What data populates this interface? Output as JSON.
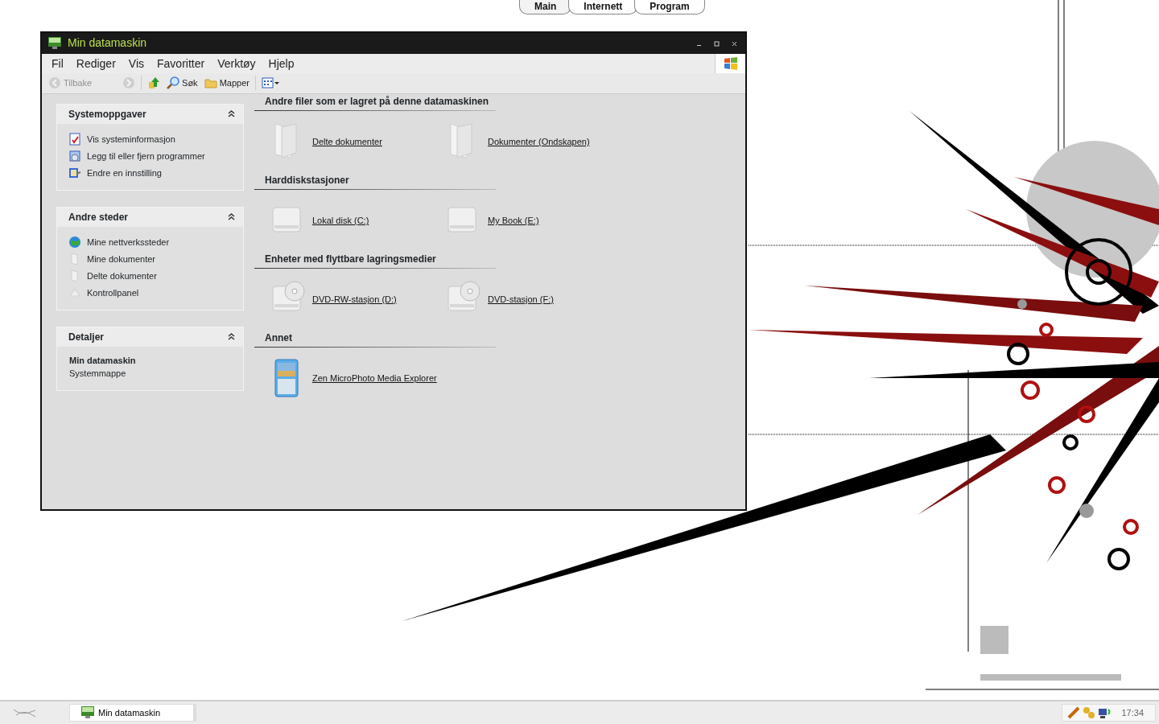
{
  "top_tabs": [
    {
      "label": "Main",
      "selected": true
    },
    {
      "label": "Internett",
      "selected": false
    },
    {
      "label": "Program",
      "selected": false
    }
  ],
  "window": {
    "title": "Min datamaskin",
    "menu": [
      "Fil",
      "Rediger",
      "Vis",
      "Favoritter",
      "Verktøy",
      "Hjelp"
    ],
    "toolbar": [
      {
        "kind": "back",
        "label": "Tilbake",
        "disabled": true
      },
      {
        "kind": "forward",
        "disabled": true
      },
      {
        "kind": "up",
        "disabled": false
      },
      {
        "kind": "search",
        "label": "Søk",
        "disabled": false
      },
      {
        "kind": "folders",
        "label": "Mapper",
        "disabled": false
      },
      {
        "kind": "views",
        "disabled": false
      }
    ],
    "panels": [
      {
        "kind": "tasks",
        "title": "Systemoppgaver",
        "expanded": true,
        "items": [
          {
            "kind": "sysinfo",
            "label": "Vis systeminformasjon"
          },
          {
            "kind": "programs",
            "label": "Legg til eller fjern programmer"
          },
          {
            "kind": "settings",
            "label": "Endre en innstilling"
          }
        ]
      },
      {
        "kind": "tasks",
        "title": "Andre steder",
        "expanded": true,
        "items": [
          {
            "kind": "network",
            "label": "Mine nettverkssteder"
          },
          {
            "kind": "folder",
            "label": "Mine dokumenter"
          },
          {
            "kind": "folder",
            "label": "Delte dokumenter"
          },
          {
            "kind": "control",
            "label": "Kontrollpanel"
          }
        ]
      },
      {
        "kind": "details",
        "title": "Detaljer",
        "expanded": true,
        "name": "Min datamaskin",
        "subtitle": "Systemmappe"
      }
    ],
    "groups": [
      {
        "title": "Andre filer som er lagret på denne datamaskinen",
        "items": [
          {
            "kind": "folder",
            "label": "Delte dokumenter"
          },
          {
            "kind": "folder",
            "label": "Dokumenter (Ondskapen)"
          }
        ]
      },
      {
        "title": "Harddiskstasjoner",
        "items": [
          {
            "kind": "drive",
            "label": "Lokal disk (C:)"
          },
          {
            "kind": "drive",
            "label": "My Book (E:)"
          }
        ]
      },
      {
        "title": "Enheter med flyttbare lagringsmedier",
        "items": [
          {
            "kind": "dvd",
            "label": "DVD-RW-stasjon (D:)"
          },
          {
            "kind": "dvd",
            "label": "DVD-stasjon (F:)"
          }
        ]
      },
      {
        "title": "Annet",
        "items": [
          {
            "kind": "player",
            "label": "Zen MicroPhoto Media Explorer"
          }
        ]
      }
    ]
  },
  "taskbar": {
    "tasks": [
      "Min datamaskin"
    ],
    "clock": "17:34"
  }
}
